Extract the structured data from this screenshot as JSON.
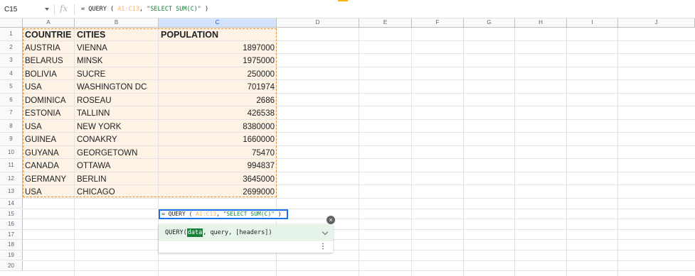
{
  "name_box": "C15",
  "formula": {
    "prefix": "= QUERY ( ",
    "range": "A1:C13",
    "sep": ", ",
    "query": "\"SELECT SUM(C)\"",
    "suffix": " )"
  },
  "columns": [
    "A",
    "B",
    "C",
    "D",
    "E",
    "F",
    "G",
    "H",
    "I",
    "J"
  ],
  "rows": [
    "1",
    "2",
    "3",
    "4",
    "5",
    "6",
    "7",
    "8",
    "9",
    "10",
    "11",
    "12",
    "13",
    "14",
    "15",
    "16",
    "17",
    "18",
    "19",
    "20"
  ],
  "table": {
    "headers": [
      "COUNTRIE",
      "CITIES",
      "POPULATION"
    ],
    "data": [
      [
        "AUSTRIA",
        "VIENNA",
        "1897000"
      ],
      [
        "BELARUS",
        "MINSK",
        "1975000"
      ],
      [
        "BOLIVIA",
        "SUCRE",
        "250000"
      ],
      [
        "USA",
        "WASHINGTON DC",
        "701974"
      ],
      [
        "DOMINICA",
        "ROSEAU",
        "2686"
      ],
      [
        "ESTONIA",
        "TALLINN",
        "426538"
      ],
      [
        "USA",
        "NEW YORK",
        "8380000"
      ],
      [
        "GUINEA",
        "CONAKRY",
        "1660000"
      ],
      [
        "GUYANA",
        "GEORGETOWN",
        "75470"
      ],
      [
        "CANADA",
        "OTTAWA",
        "994837"
      ],
      [
        "GERMANY",
        "BERLIN",
        "3645000"
      ],
      [
        "USA",
        "CHICAGO",
        "2699000"
      ]
    ]
  },
  "autocomplete": {
    "fn": "QUERY(",
    "arg_active": "data",
    "rest": ", query, [headers])",
    "close_glyph": "×",
    "more_glyph": "⋮"
  },
  "colors": {
    "accent": "#1a73e8",
    "range": "#e69138",
    "range_bg": "#fdf2e4",
    "hint_bg": "#e6f4ea"
  }
}
